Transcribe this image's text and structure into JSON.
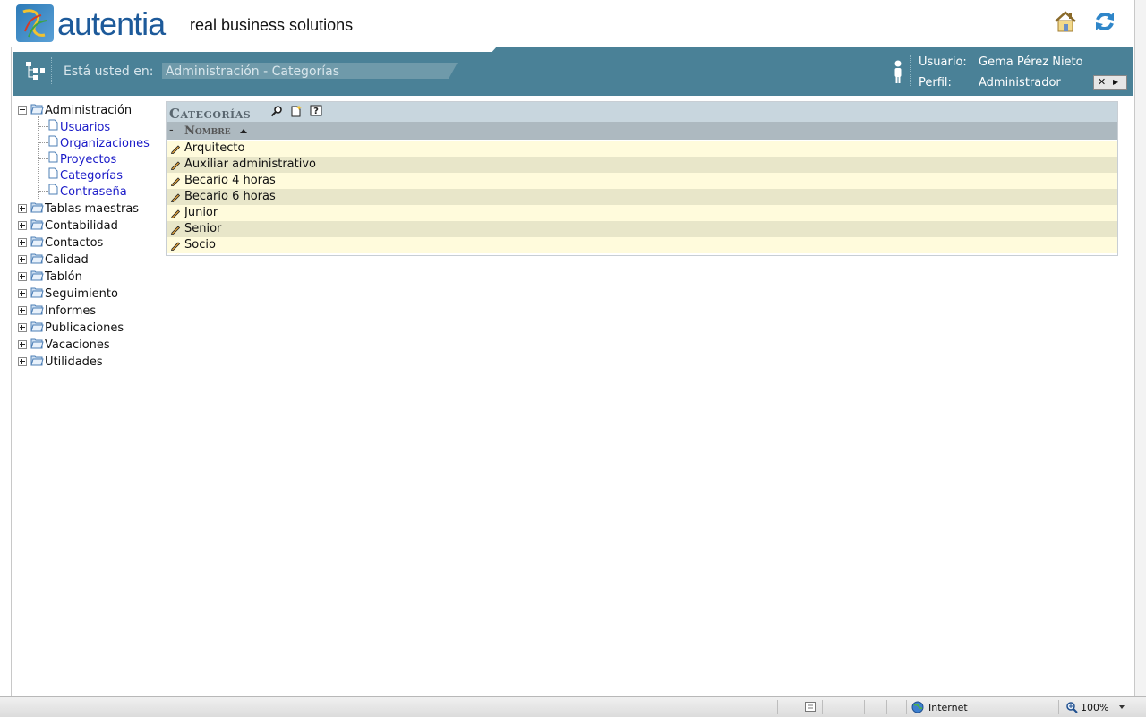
{
  "brand": {
    "name": "autentia",
    "tagline": "real business solutions"
  },
  "nav": {
    "location_label": "Está usted en:",
    "location_value": "Administración - Categorías",
    "user_label": "Usuario:",
    "user_value": "Gema Pérez Nieto",
    "profile_label": "Perfil:",
    "profile_value": "Administrador"
  },
  "sidebar": {
    "admin": {
      "label": "Administración",
      "children": [
        "Usuarios",
        "Organizaciones",
        "Proyectos",
        "Categorías",
        "Contraseña"
      ]
    },
    "sections": [
      "Tablas maestras",
      "Contabilidad",
      "Contactos",
      "Calidad",
      "Tablón",
      "Seguimiento",
      "Informes",
      "Publicaciones",
      "Vacaciones",
      "Utilidades"
    ]
  },
  "panel": {
    "title": "Categorías",
    "collapse_symbol": "-",
    "column_name": "Nombre",
    "rows": [
      "Arquitecto",
      "Auxiliar administrativo",
      "Becario 4 horas",
      "Becario 6 horas",
      "Junior",
      "Senior",
      "Socio"
    ]
  },
  "status": {
    "zone": "Internet",
    "zoom": "100%"
  },
  "colors": {
    "bar": "#4a8197",
    "row_odd": "#fffbdc",
    "row_even": "#e8e6c9",
    "header": "#c8d6de",
    "link": "#1a1ac8"
  }
}
